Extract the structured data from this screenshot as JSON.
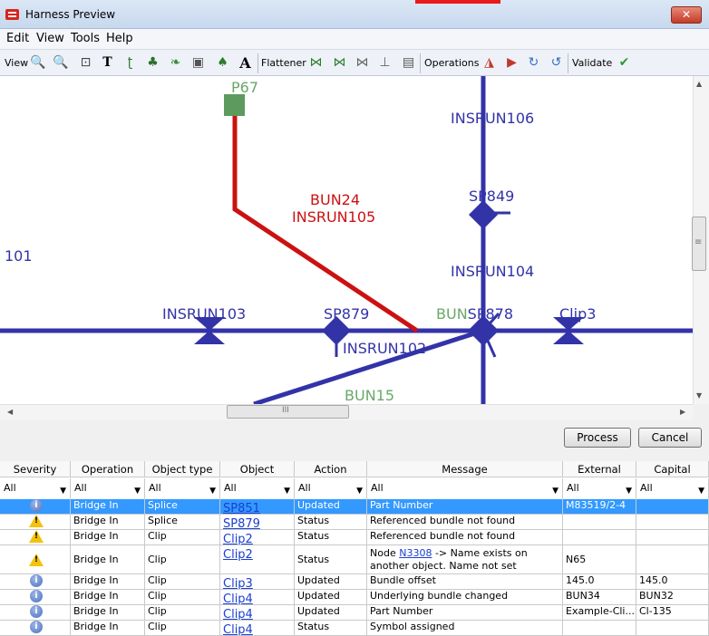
{
  "window": {
    "title": "Harness Preview",
    "close_label": "✕"
  },
  "menu": [
    "Edit",
    "View",
    "Tools",
    "Help"
  ],
  "toolbar": {
    "view_label": "View",
    "flattener_label": "Flattener",
    "operations_label": "Operations",
    "validate_label": "Validate",
    "validate_icon": "✔"
  },
  "diagram": {
    "labels": {
      "p67": "P67",
      "insrun106": "INSRUN106",
      "bun24": "BUN24",
      "insrun105": "INSRUN105",
      "sp849": "SP849",
      "n101": "101",
      "insrun104": "INSRUN104",
      "insrun103": "INSRUN103",
      "sp879": "SP879",
      "bunsp878": "BUNSP878",
      "clip3": "Clip3",
      "insrun102": "INSRUN102",
      "bun15": "BUN15"
    },
    "colors": {
      "bundle": "#3333a8",
      "highlight": "#cc1111",
      "connector": "#5d9a5d",
      "connector_label": "#6aa86a",
      "red_label": "#cc1111",
      "blue_label": "#3333a8",
      "green_label": "#6aa86a"
    }
  },
  "scroll": {
    "h_grip": "III",
    "v_grip": "≡"
  },
  "buttons": {
    "process": "Process",
    "cancel": "Cancel"
  },
  "grid": {
    "headers": [
      "Severity",
      "Operation",
      "Object type",
      "Object",
      "Action",
      "Message",
      "External",
      "Capital"
    ],
    "filters": [
      "All",
      "All",
      "All",
      "All",
      "All",
      "All",
      "All",
      "All"
    ],
    "rows": [
      {
        "severity": "info",
        "operation": "Bridge In",
        "type": "Splice",
        "object": "SP851",
        "action": "Updated",
        "message": "Part Number",
        "external": "M83519/2-4",
        "capital": "",
        "selected": true
      },
      {
        "severity": "warning",
        "operation": "Bridge In",
        "type": "Splice",
        "object": "SP879",
        "action": "Status",
        "message": "Referenced bundle not found",
        "external": "",
        "capital": ""
      },
      {
        "severity": "warning",
        "operation": "Bridge In",
        "type": "Clip",
        "object": "Clip2",
        "action": "Status",
        "message": "Referenced bundle not found",
        "external": "",
        "capital": ""
      },
      {
        "severity": "warning",
        "operation": "Bridge In",
        "type": "Clip",
        "object": "Clip2",
        "action": "Status",
        "message_pre": "Node ",
        "message_link": "N3308",
        "message_post": " -> Name exists on another object. Name not set",
        "external": "N65",
        "capital": ""
      },
      {
        "severity": "info",
        "operation": "Bridge In",
        "type": "Clip",
        "object": "Clip3",
        "action": "Updated",
        "message": "Bundle offset",
        "external": "145.0",
        "capital": "145.0"
      },
      {
        "severity": "info",
        "operation": "Bridge In",
        "type": "Clip",
        "object": "Clip4",
        "action": "Updated",
        "message": "Underlying bundle changed",
        "external": "BUN34",
        "capital": "BUN32"
      },
      {
        "severity": "info",
        "operation": "Bridge In",
        "type": "Clip",
        "object": "Clip4",
        "action": "Updated",
        "message": "Part Number",
        "external": "Example-Cli...",
        "capital": "Cl-135"
      },
      {
        "severity": "info",
        "operation": "Bridge In",
        "type": "Clip",
        "object": "Clip4",
        "action": "Status",
        "message": "Symbol assigned",
        "external": "",
        "capital": ""
      }
    ]
  }
}
